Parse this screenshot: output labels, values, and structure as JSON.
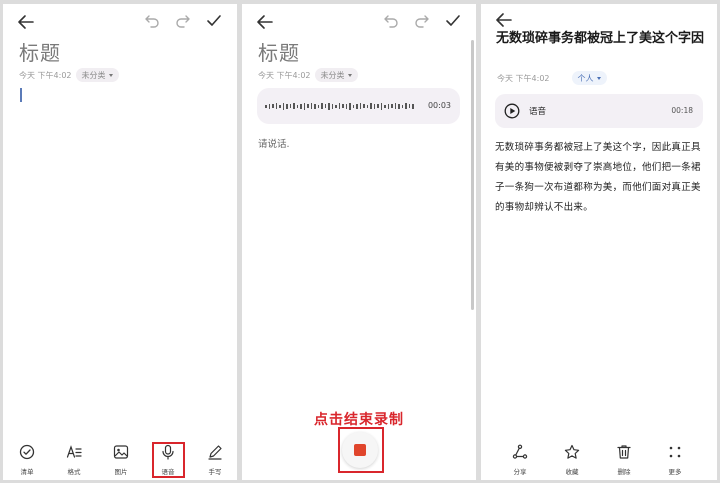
{
  "panel1": {
    "title_placeholder": "标题",
    "meta": {
      "date": "今天 下午4:02",
      "category": "未分类"
    },
    "toolbar": [
      {
        "id": "checklist",
        "label": "清单",
        "icon": "checklist-icon"
      },
      {
        "id": "style",
        "label": "格式",
        "icon": "text-format-icon"
      },
      {
        "id": "image",
        "label": "图片",
        "icon": "image-icon"
      },
      {
        "id": "voice",
        "label": "语音",
        "icon": "microphone-icon"
      },
      {
        "id": "handwrite",
        "label": "手写",
        "icon": "pen-icon"
      }
    ]
  },
  "panel2": {
    "title_placeholder": "标题",
    "meta": {
      "date": "今天 下午4:02",
      "category": "未分类"
    },
    "recording": {
      "time": "00:03",
      "hint": "请说话."
    },
    "caption": "点击结束录制"
  },
  "panel3": {
    "note_title": "无数琐碎事务都被冠上了美这个字因",
    "meta": {
      "date": "今天 下午4:02",
      "category": "个人"
    },
    "voice_card": {
      "label": "语音",
      "duration": "00:18"
    },
    "body": "无数琐碎事务都被冠上了美这个字，因此真正具有美的事物便被剥夺了崇高地位，他们把一条裙子一条狗一次布道都称为美，而他们面对真正美的事物却辨认不出来。",
    "toolbar": [
      {
        "id": "share",
        "label": "分享",
        "icon": "share-icon"
      },
      {
        "id": "favorite",
        "label": "收藏",
        "icon": "star-icon"
      },
      {
        "id": "delete",
        "label": "删除",
        "icon": "trash-icon"
      },
      {
        "id": "more",
        "label": "更多",
        "icon": "more-dots-icon"
      }
    ]
  },
  "colors": {
    "highlight": "#d9262c",
    "stop_button": "#e0452c",
    "card_bg": "#f3f0f5"
  }
}
